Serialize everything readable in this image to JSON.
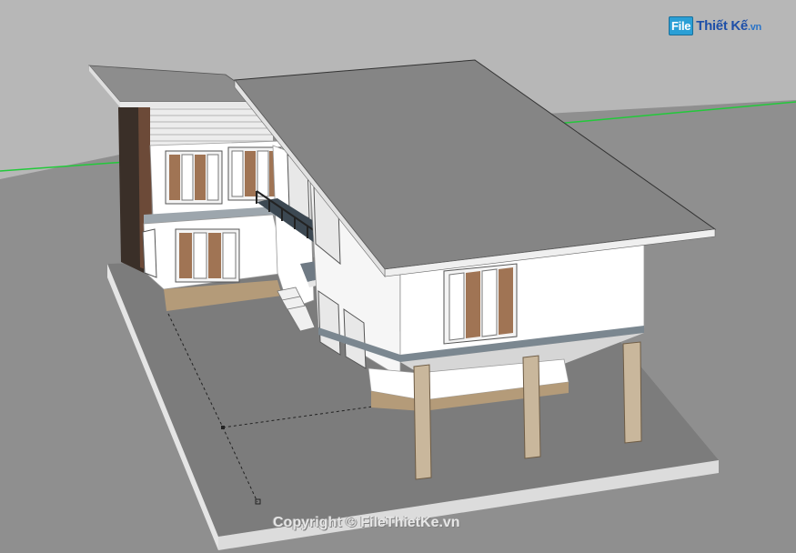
{
  "logo": {
    "part1": "File",
    "part2": "Thiết Kế",
    "suffix": ".vn"
  },
  "watermark": {
    "text": "Copyright © FileThietKe.vn"
  },
  "colors": {
    "background": "#b7b7b7",
    "ground": "#8f8f8f",
    "base_slab": "#7d7d7d",
    "roof": "#858585",
    "wall": "#ffffff",
    "wood": "#8b6e55",
    "axis_green": "#22c93a"
  }
}
